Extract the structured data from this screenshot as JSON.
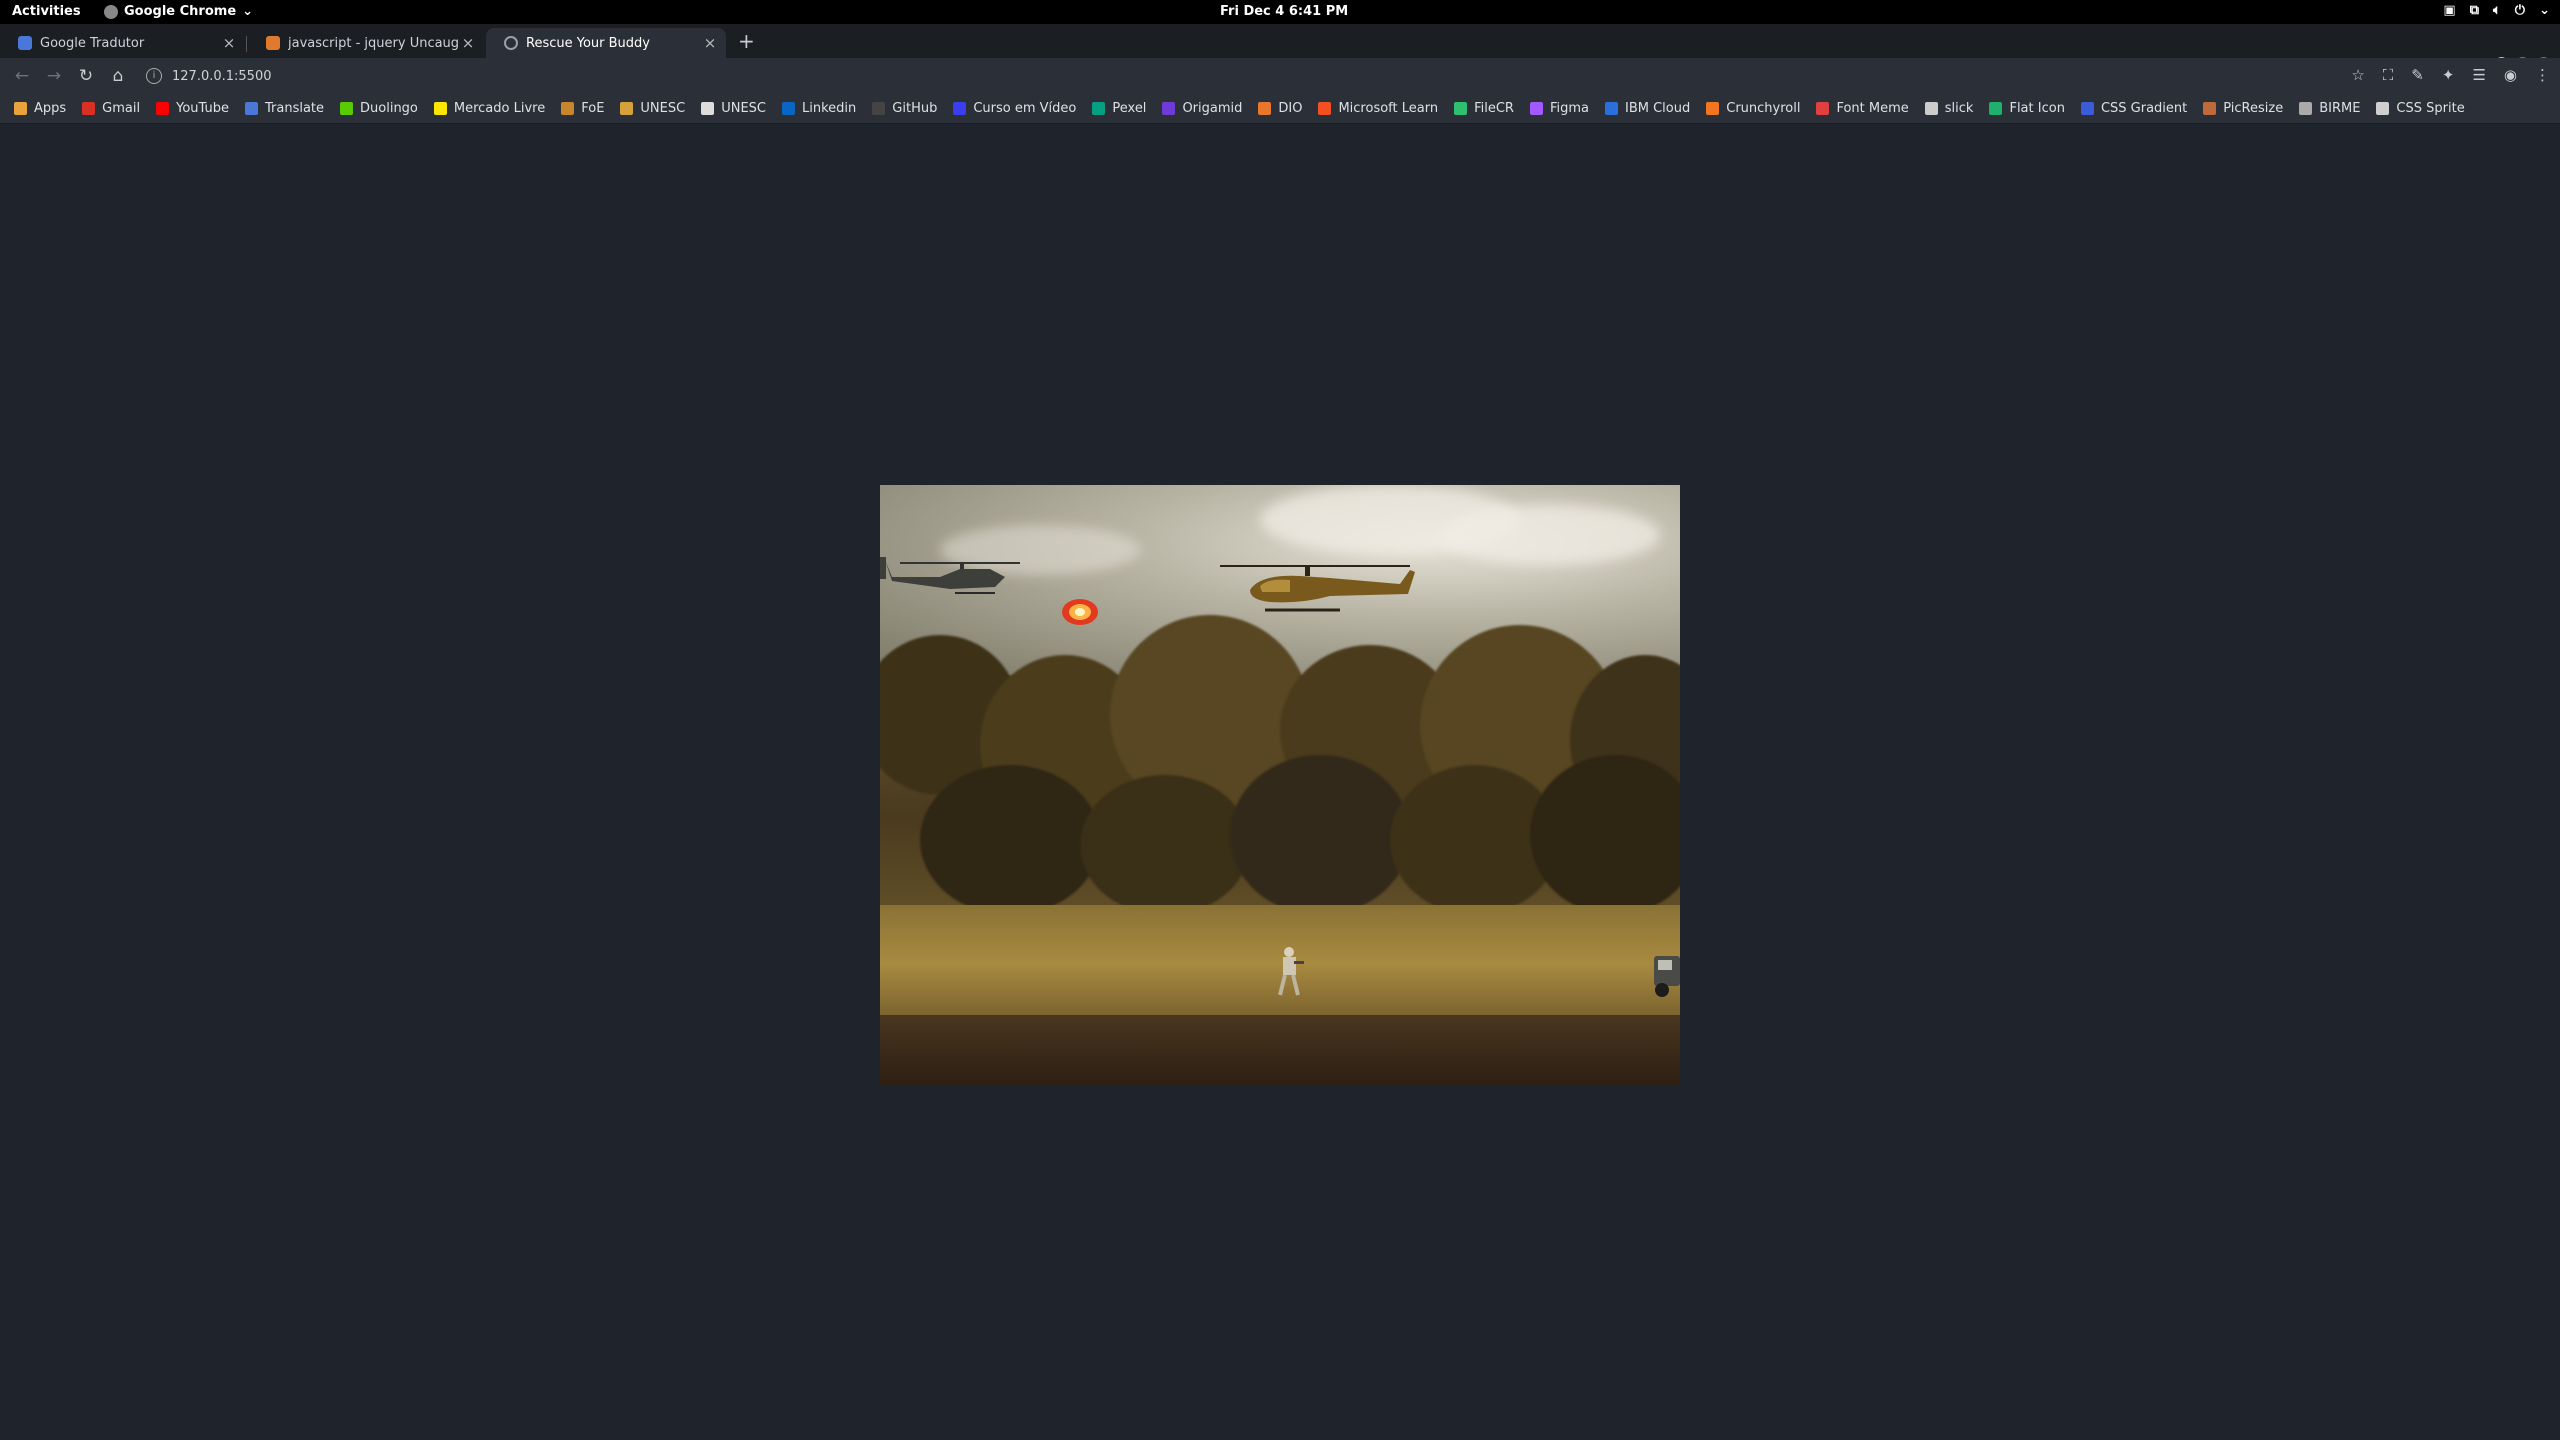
{
  "topbar": {
    "activities": "Activities",
    "app_name": "Google Chrome",
    "clock": "Fri Dec 4   6:41 PM"
  },
  "tabs": [
    {
      "title": "Google Tradutor",
      "icon_color": "#4a78d8",
      "active": false
    },
    {
      "title": "javascript - jquery Uncaught",
      "icon_color": "#e07a2e",
      "active": false
    },
    {
      "title": "Rescue Your Buddy",
      "icon_color": "#9aa0a6",
      "active": true
    }
  ],
  "toolbar": {
    "url": "127.0.0.1:5500"
  },
  "bookmarks": [
    {
      "label": "Apps",
      "color": "#e8a33d"
    },
    {
      "label": "Gmail",
      "color": "#d93025"
    },
    {
      "label": "YouTube",
      "color": "#ff0000"
    },
    {
      "label": "Translate",
      "color": "#4a78d8"
    },
    {
      "label": "Duolingo",
      "color": "#58cc02"
    },
    {
      "label": "Mercado Livre",
      "color": "#ffe600"
    },
    {
      "label": "FoE",
      "color": "#c8862a"
    },
    {
      "label": "UNESC",
      "color": "#d6a13a"
    },
    {
      "label": "UNESC",
      "color": "#dddddd"
    },
    {
      "label": "Linkedin",
      "color": "#0a66c2"
    },
    {
      "label": "GitHub",
      "color": "#444444"
    },
    {
      "label": "Curso em Vídeo",
      "color": "#3d3df0"
    },
    {
      "label": "Pexel",
      "color": "#05a081"
    },
    {
      "label": "Origamid",
      "color": "#6f3bd8"
    },
    {
      "label": "DIO",
      "color": "#e8762c"
    },
    {
      "label": "Microsoft Learn",
      "color": "#f25022"
    },
    {
      "label": "FileCR",
      "color": "#2fbf71"
    },
    {
      "label": "Figma",
      "color": "#a259ff"
    },
    {
      "label": "IBM Cloud",
      "color": "#2a6fdb"
    },
    {
      "label": "Crunchyroll",
      "color": "#f47521"
    },
    {
      "label": "Font Meme",
      "color": "#e04040"
    },
    {
      "label": "slick",
      "color": "#cccccc"
    },
    {
      "label": "Flat Icon",
      "color": "#1fb06d"
    },
    {
      "label": "CSS Gradient",
      "color": "#3b5bd8"
    },
    {
      "label": "PicResize",
      "color": "#c06a3c"
    },
    {
      "label": "BIRME",
      "color": "#aaaaaa"
    },
    {
      "label": "CSS Sprite",
      "color": "#cfcfcf"
    }
  ],
  "colors": {
    "page_bg": "#1f242c",
    "chrome_bg": "#2b3038",
    "tabstrip_bg": "#1b1f24"
  },
  "game": {
    "name": "Rescue Your Buddy"
  }
}
